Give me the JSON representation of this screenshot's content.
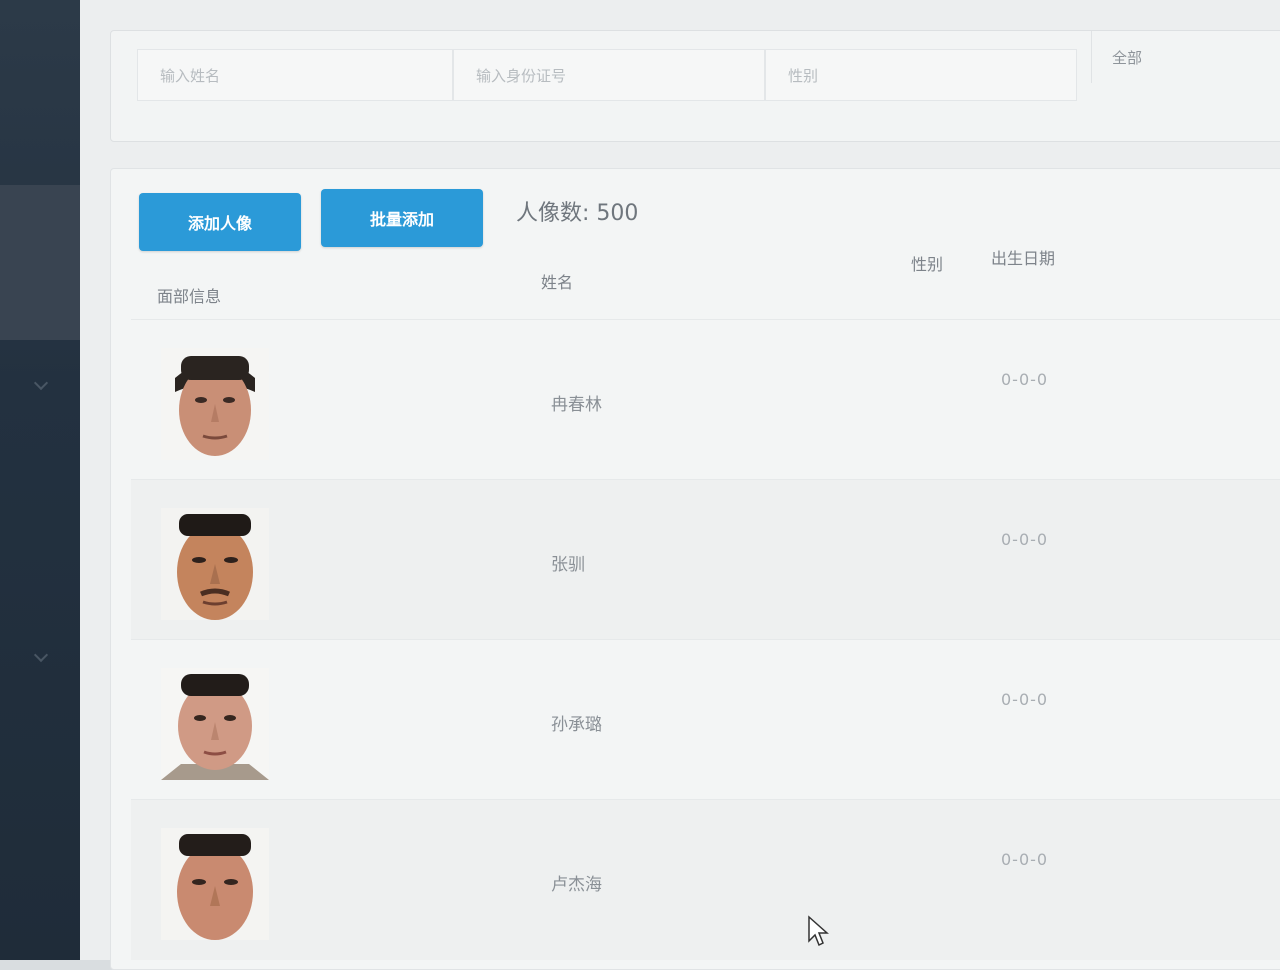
{
  "filters": {
    "name_placeholder": "输入姓名",
    "id_placeholder": "输入身份证号",
    "gender_placeholder": "性别",
    "scope_value": "全部"
  },
  "toolbar": {
    "add_label": "添加人像",
    "batch_label": "批量添加",
    "count_label": "人像数:",
    "count_value": "500"
  },
  "table": {
    "headers": {
      "face": "面部信息",
      "name": "姓名",
      "gender": "性别",
      "birth": "出生日期"
    },
    "rows": [
      {
        "name": "冉春林",
        "birth": "0-0-0"
      },
      {
        "name": "张驯",
        "birth": "0-0-0"
      },
      {
        "name": "孙承璐",
        "birth": "0-0-0"
      },
      {
        "name": "卢杰海",
        "birth": "0-0-0"
      }
    ]
  },
  "colors": {
    "accent": "#2b9ad8",
    "sidebar": "#233140"
  }
}
